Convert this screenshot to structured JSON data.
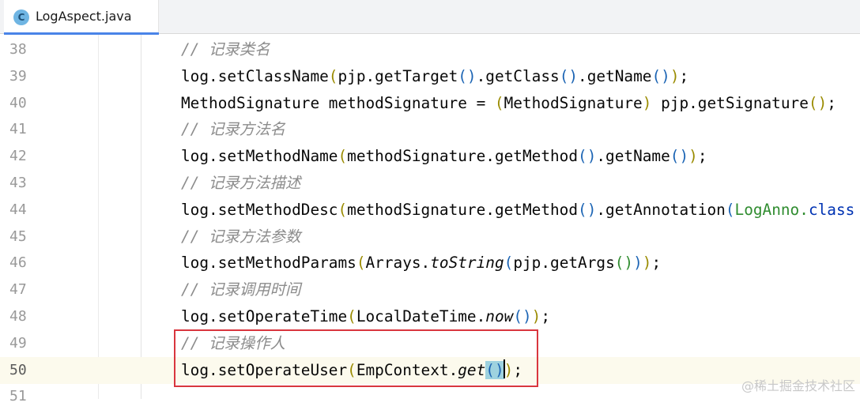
{
  "tab": {
    "title": "LogAspect.java",
    "icon_letter": "C",
    "icon": "java-class-icon"
  },
  "colors": {
    "comment": "#8c8c8c",
    "paren_level1": "#9a8b00",
    "paren_level2": "#1b64b4",
    "paren_level3": "#2f8c2f",
    "keyword": "#0033b3",
    "highlight_box": "#d9363e",
    "current_line": "#fcfaed",
    "tab_underline": "#4a84e8"
  },
  "editor": {
    "lines": [
      {
        "number": "38",
        "tokens": [
          {
            "t": "// 记录类名",
            "c": "cm"
          }
        ]
      },
      {
        "number": "39",
        "tokens": [
          {
            "t": "log.setClassName"
          },
          {
            "t": "(",
            "c": "p1"
          },
          {
            "t": "pjp.getTarget"
          },
          {
            "t": "()",
            "c": "p2"
          },
          {
            "t": ".getClass"
          },
          {
            "t": "()",
            "c": "p2"
          },
          {
            "t": ".getName"
          },
          {
            "t": "()",
            "c": "p2"
          },
          {
            "t": ")",
            "c": "p1"
          },
          {
            "t": ";"
          }
        ]
      },
      {
        "number": "40",
        "tokens": [
          {
            "t": "MethodSignature methodSignature = "
          },
          {
            "t": "(",
            "c": "p1"
          },
          {
            "t": "MethodSignature"
          },
          {
            "t": ")",
            "c": "p1"
          },
          {
            "t": " pjp.getSignature"
          },
          {
            "t": "()",
            "c": "p1"
          },
          {
            "t": ";"
          }
        ]
      },
      {
        "number": "41",
        "tokens": [
          {
            "t": "// 记录方法名",
            "c": "cm"
          }
        ]
      },
      {
        "number": "42",
        "tokens": [
          {
            "t": "log.setMethodName"
          },
          {
            "t": "(",
            "c": "p1"
          },
          {
            "t": "methodSignature.getMethod"
          },
          {
            "t": "()",
            "c": "p2"
          },
          {
            "t": ".getName"
          },
          {
            "t": "()",
            "c": "p2"
          },
          {
            "t": ")",
            "c": "p1"
          },
          {
            "t": ";"
          }
        ]
      },
      {
        "number": "43",
        "tokens": [
          {
            "t": "// 记录方法描述",
            "c": "cm"
          }
        ]
      },
      {
        "number": "44",
        "tokens": [
          {
            "t": "log.setMethodDesc"
          },
          {
            "t": "(",
            "c": "p1"
          },
          {
            "t": "methodSignature.getMethod"
          },
          {
            "t": "()",
            "c": "p2"
          },
          {
            "t": ".getAnnotation"
          },
          {
            "t": "(",
            "c": "p2"
          },
          {
            "t": "LogAnno",
            "c": "p3"
          },
          {
            "t": ".",
            "c": "p3"
          },
          {
            "t": "class",
            "c": "kw"
          }
        ]
      },
      {
        "number": "45",
        "tokens": [
          {
            "t": "// 记录方法参数",
            "c": "cm"
          }
        ]
      },
      {
        "number": "46",
        "tokens": [
          {
            "t": "log.setMethodParams"
          },
          {
            "t": "(",
            "c": "p1"
          },
          {
            "t": "Arrays."
          },
          {
            "t": "toString",
            "c": "st"
          },
          {
            "t": "(",
            "c": "p2"
          },
          {
            "t": "pjp.getArgs"
          },
          {
            "t": "()",
            "c": "p3"
          },
          {
            "t": ")",
            "c": "p2"
          },
          {
            "t": ")",
            "c": "p1"
          },
          {
            "t": ";"
          }
        ]
      },
      {
        "number": "47",
        "tokens": [
          {
            "t": "// 记录调用时间",
            "c": "cm"
          }
        ]
      },
      {
        "number": "48",
        "tokens": [
          {
            "t": "log.setOperateTime"
          },
          {
            "t": "(",
            "c": "p1"
          },
          {
            "t": "LocalDateTime."
          },
          {
            "t": "now",
            "c": "st"
          },
          {
            "t": "()",
            "c": "p2"
          },
          {
            "t": ")",
            "c": "p1"
          },
          {
            "t": ";"
          }
        ]
      },
      {
        "number": "49",
        "tokens": [
          {
            "t": "// 记录操作人",
            "c": "cm"
          }
        ]
      },
      {
        "number": "50",
        "current": true,
        "tokens": [
          {
            "t": "log.setOperateUser"
          },
          {
            "t": "(",
            "c": "p1"
          },
          {
            "t": "EmpContext."
          },
          {
            "t": "get",
            "c": "st"
          },
          {
            "t": "(",
            "c": "p2 match"
          },
          {
            "t": ")",
            "c": "p2 match"
          },
          {
            "t": "|",
            "c": "caret"
          },
          {
            "t": ")",
            "c": "p1"
          },
          {
            "t": ";"
          }
        ]
      },
      {
        "number": "51",
        "tokens": []
      }
    ]
  },
  "watermark": "@稀土掘金技术社区"
}
